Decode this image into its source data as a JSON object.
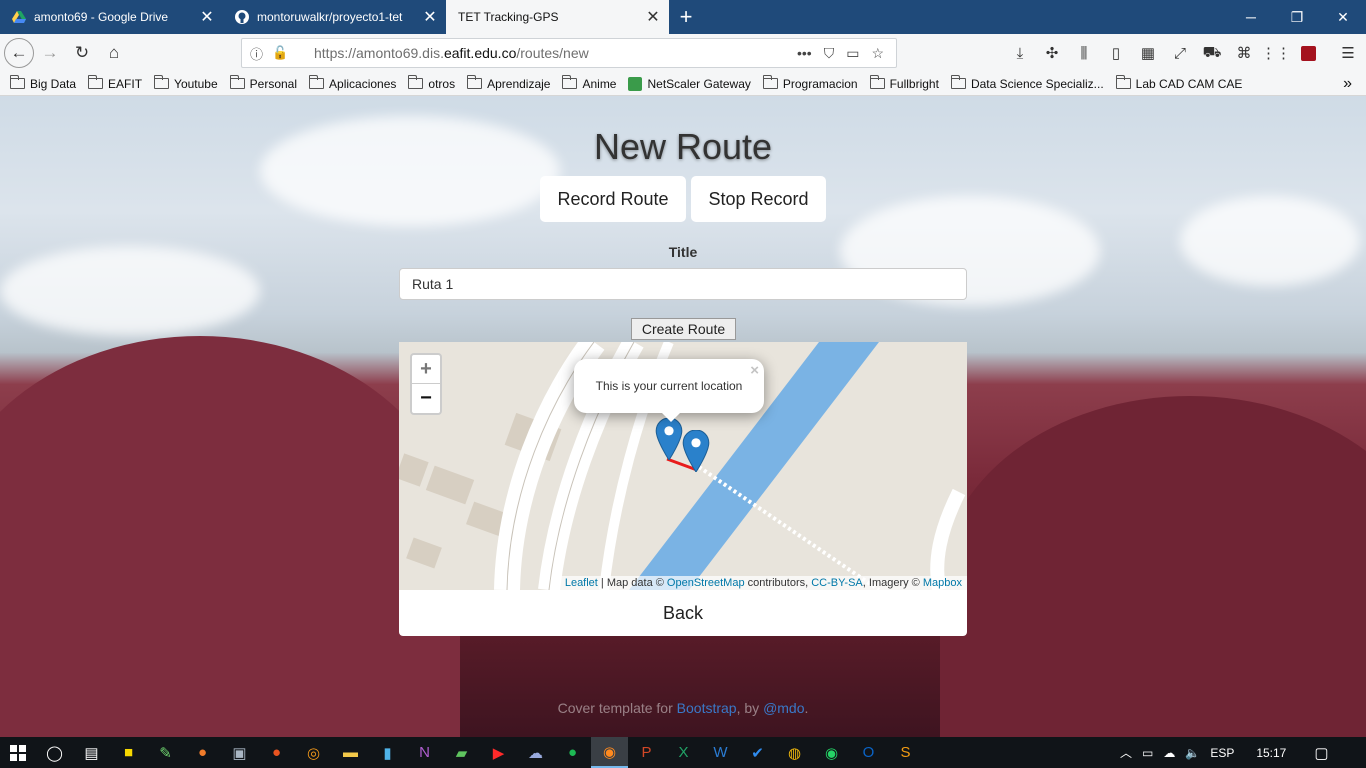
{
  "tabs": [
    {
      "title": "amonto69 - Google Drive",
      "icon": "google-drive-icon"
    },
    {
      "title": "montoruwalkr/proyecto1-tet",
      "icon": "github-icon"
    },
    {
      "title": "TET Tracking-GPS",
      "icon": "none"
    }
  ],
  "new_tab": "+",
  "window_controls": {
    "minimize": "─",
    "restore": "❐",
    "close": "✕"
  },
  "address": {
    "url_prefix": "https://amonto69.dis.",
    "url_domain": "eafit.edu.co",
    "url_path": "/routes/new"
  },
  "bookmarks": [
    "Big Data",
    "EAFIT",
    "Youtube",
    "Personal",
    "Aplicaciones",
    "otros",
    "Aprendizaje",
    "Anime",
    "NetScaler Gateway",
    "Programacion",
    "Fullbright",
    "Data Science Specializ...",
    "Lab CAD CAM CAE"
  ],
  "page": {
    "heading": "New Route",
    "record_label": "Record Route",
    "stop_label": "Stop Record",
    "title_label": "Title",
    "title_value": "Ruta 1",
    "create_label": "Create Route",
    "back_label": "Back"
  },
  "map": {
    "zoom_in": "+",
    "zoom_out": "−",
    "popup_text": "This is your current location",
    "popup_close": "×",
    "attribution": {
      "leaflet": "Leaflet",
      "sep1": " | Map data © ",
      "osm": "OpenStreetMap",
      "sep2": " contributors, ",
      "license": "CC-BY-SA",
      "sep3": ", Imagery © ",
      "mapbox": "Mapbox"
    },
    "water_color": "#7ab3e4",
    "marker_color": "#2a81cb"
  },
  "footer": {
    "prefix": "Cover template for ",
    "bootstrap": "Bootstrap",
    "by": ", by ",
    "author": "@mdo",
    "suffix": "."
  },
  "taskbar": {
    "language": "ESP",
    "time": "15:17"
  }
}
